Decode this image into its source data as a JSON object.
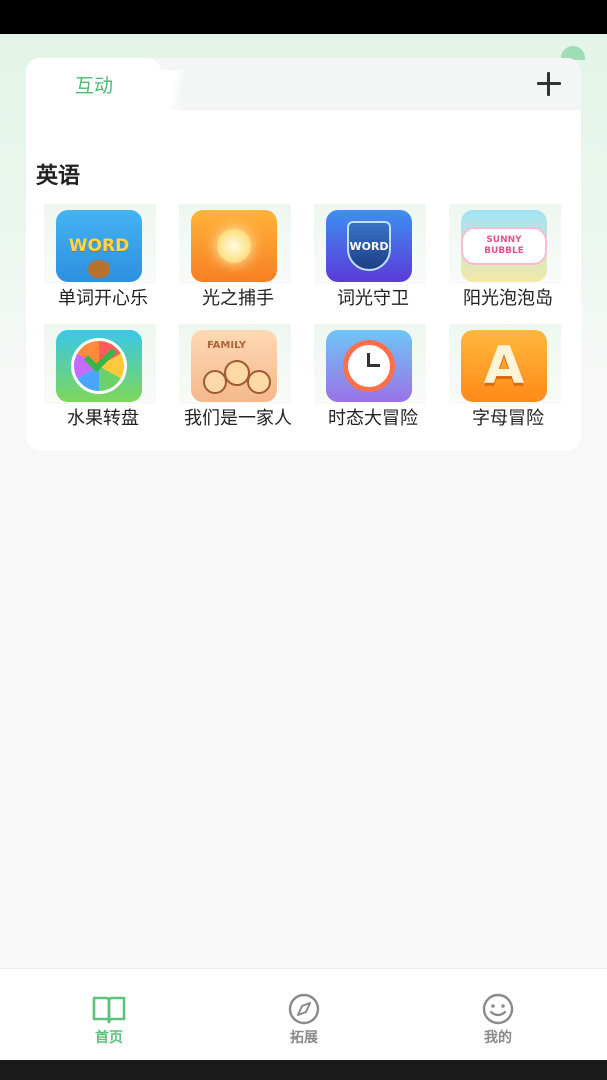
{
  "tabs": {
    "active_label": "互动"
  },
  "section": {
    "title": "英语"
  },
  "apps": [
    {
      "label": "单词开心乐",
      "icon": "happy-word-icon"
    },
    {
      "label": "光之捕手",
      "icon": "sun-catcher-icon"
    },
    {
      "label": "词光守卫",
      "icon": "word-shield-icon"
    },
    {
      "label": "阳光泡泡岛",
      "icon": "sunny-bubble-icon"
    },
    {
      "label": "水果转盘",
      "icon": "fruit-wheel-icon"
    },
    {
      "label": "我们是一家人",
      "icon": "family-icon"
    },
    {
      "label": "时态大冒险",
      "icon": "alarm-clock-icon"
    },
    {
      "label": "字母冒险",
      "icon": "letter-a-icon"
    }
  ],
  "icon_text": {
    "word": "WORD",
    "shield_word": "WORD",
    "bubble": "SUNNY BUBBLE",
    "family": "FAMILY",
    "letter": "A"
  },
  "bottom_nav": [
    {
      "label": "首页",
      "icon": "book-icon",
      "active": true
    },
    {
      "label": "拓展",
      "icon": "compass-icon",
      "active": false
    },
    {
      "label": "我的",
      "icon": "smiley-icon",
      "active": false
    }
  ],
  "colors": {
    "accent": "#5cc27c",
    "inactive": "#8a8a8a"
  }
}
